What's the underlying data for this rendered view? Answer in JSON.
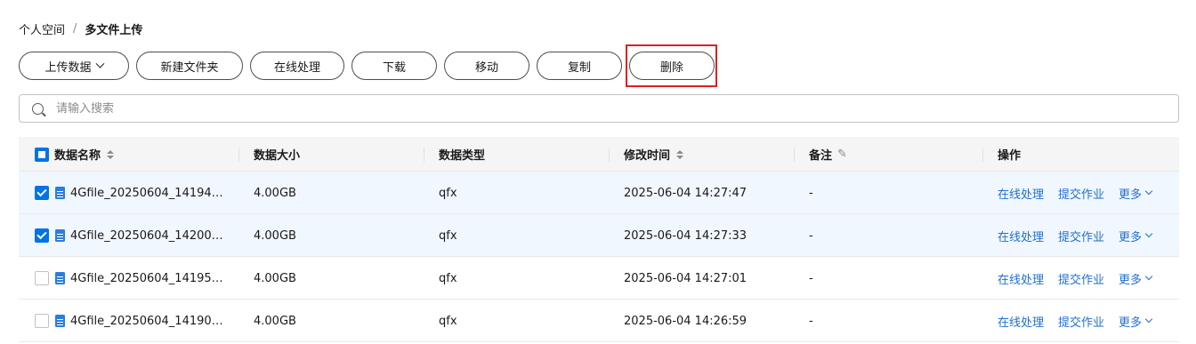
{
  "breadcrumb": {
    "parent": "个人空间",
    "separator": "/",
    "current": "多文件上传"
  },
  "toolbar": {
    "upload": "上传数据",
    "new_folder": "新建文件夹",
    "online_process": "在线处理",
    "download": "下载",
    "move": "移动",
    "copy": "复制",
    "delete": "删除"
  },
  "search": {
    "placeholder": "请输入搜索"
  },
  "table": {
    "headers": {
      "name": "数据名称",
      "size": "数据大小",
      "type": "数据类型",
      "modified": "修改时间",
      "note": "备注",
      "actions": "操作"
    },
    "rows": [
      {
        "checked": true,
        "name": "4Gfile_20250604_14194…",
        "size": "4.00GB",
        "type": "qfx",
        "modified": "2025-06-04 14:27:47",
        "note": "-",
        "action1": "在线处理",
        "action2": "提交作业",
        "action3": "更多"
      },
      {
        "checked": true,
        "name": "4Gfile_20250604_14200…",
        "size": "4.00GB",
        "type": "qfx",
        "modified": "2025-06-04 14:27:33",
        "note": "-",
        "action1": "在线处理",
        "action2": "提交作业",
        "action3": "更多"
      },
      {
        "checked": false,
        "name": "4Gfile_20250604_14195…",
        "size": "4.00GB",
        "type": "qfx",
        "modified": "2025-06-04 14:27:01",
        "note": "-",
        "action1": "在线处理",
        "action2": "提交作业",
        "action3": "更多"
      },
      {
        "checked": false,
        "name": "4Gfile_20250604_14190…",
        "size": "4.00GB",
        "type": "qfx",
        "modified": "2025-06-04 14:26:59",
        "note": "-",
        "action1": "在线处理",
        "action2": "提交作业",
        "action3": "更多"
      }
    ]
  },
  "colors": {
    "accent": "#0073e6",
    "link": "#1f6fd1",
    "highlight": "#e02020",
    "selected_row": "#f1f7fe"
  }
}
